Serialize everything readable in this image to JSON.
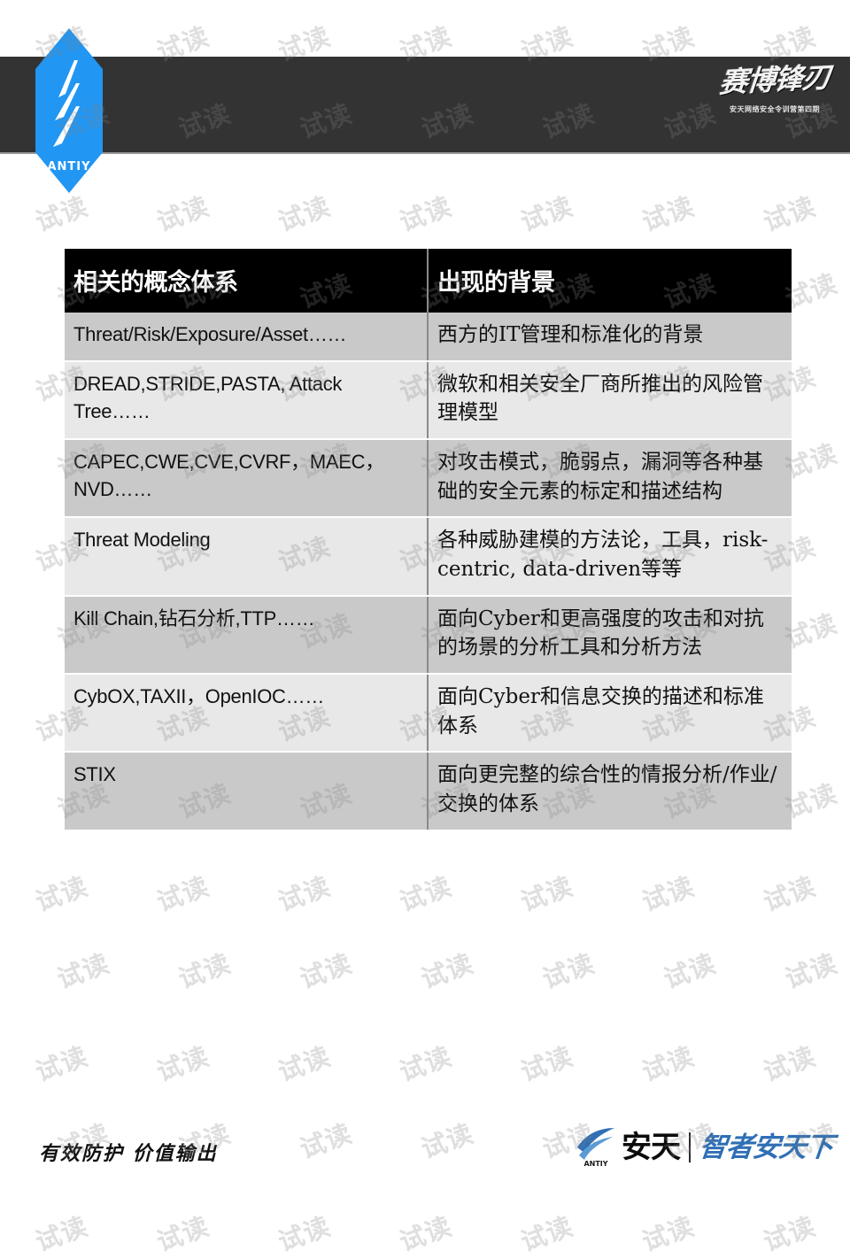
{
  "slide": {
    "brand_logo_text": "ANTIY",
    "calligraphy_title": "赛博锋刃",
    "calligraphy_subtitle": "安天网络安全令训营第四期",
    "watermark_text": "试读"
  },
  "table": {
    "headers": [
      "相关的概念体系",
      "出现的背景"
    ],
    "rows": [
      {
        "concept": "Threat/Risk/Exposure/Asset……",
        "background": "西方的IT管理和标准化的背景"
      },
      {
        "concept": "DREAD,STRIDE,PASTA, Attack Tree……",
        "background": "微软和相关安全厂商所推出的风险管理模型"
      },
      {
        "concept": "CAPEC,CWE,CVE,CVRF，MAEC，NVD……",
        "background": "对攻击模式，脆弱点，漏洞等各种基础的安全元素的标定和描述结构"
      },
      {
        "concept": "Threat Modeling",
        "background": "各种威胁建模的方法论，工具，risk-centric, data-driven等等"
      },
      {
        "concept": "Kill Chain,钻石分析,TTP……",
        "background": "面向Cyber和更高强度的攻击和对抗的场景的分析工具和分析方法"
      },
      {
        "concept": "CybOX,TAXII，OpenIOC……",
        "background": "面向Cyber和信息交换的描述和标准体系"
      },
      {
        "concept": "STIX",
        "background": "面向更完整的综合性的情报分析/作业/交换的体系"
      }
    ]
  },
  "footer": {
    "slogan": "有效防护 价值输出",
    "brand_name": "安天",
    "brand_tagline": "智者安天下"
  },
  "colors": {
    "header_band": "#333333",
    "logo_blue": "#2196f3",
    "table_header_bg": "#000000",
    "row_dark": "#c9c9c9",
    "row_light": "#e8e8e8",
    "tagline_blue": "#2f6fb5"
  }
}
